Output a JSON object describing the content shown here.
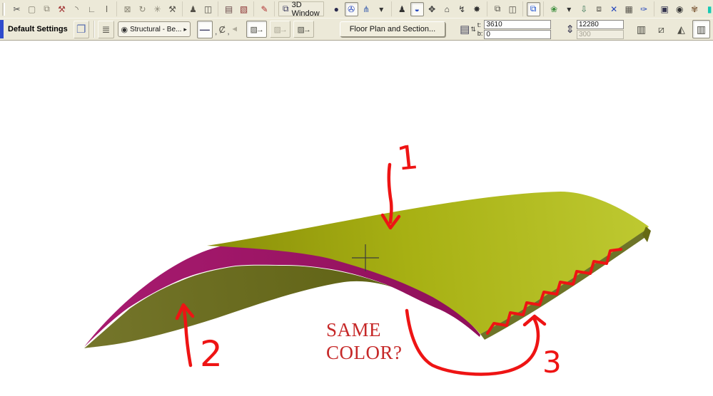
{
  "toolbar_top": {
    "window_button": {
      "label": "3D Window",
      "icon": "⧉"
    },
    "group1": [
      {
        "name": "scissors-icon",
        "glyph": "✂",
        "color": "#4a4a4a"
      },
      {
        "name": "fold-rect-icon",
        "glyph": "▢",
        "color": "#8a8676"
      },
      {
        "name": "copy-rect-icon",
        "glyph": "⧉",
        "color": "#8a8676"
      },
      {
        "name": "pick-hammer-icon",
        "glyph": "⚒",
        "color": "#a23535"
      },
      {
        "name": "fillet-arc-icon",
        "glyph": "◝",
        "color": "#6a675c"
      },
      {
        "name": "corner-tool-icon",
        "glyph": "∟",
        "color": "#6a675c"
      },
      {
        "name": "beam-tool-icon",
        "glyph": "Ⅰ",
        "color": "#6a675c"
      }
    ],
    "group2": [
      {
        "name": "delete-box-icon",
        "glyph": "⊠",
        "color": "#8a8676"
      },
      {
        "name": "rotate-icon",
        "glyph": "↻",
        "color": "#8a8676"
      },
      {
        "name": "explode-icon",
        "glyph": "✳",
        "color": "#8a8676"
      },
      {
        "name": "hammer-icon",
        "glyph": "⚒",
        "color": "#55524a"
      }
    ],
    "group3": [
      {
        "name": "walk-figure-icon",
        "glyph": "♟",
        "color": "#55524a"
      },
      {
        "name": "copy-element-icon",
        "glyph": "◫",
        "color": "#55524a"
      }
    ],
    "group4": [
      {
        "name": "print-icon",
        "glyph": "▤",
        "color": "#6a4a4a"
      },
      {
        "name": "publish-icon",
        "glyph": "▧",
        "color": "#8b3030"
      }
    ],
    "group5": [
      {
        "name": "markup-pencil-icon",
        "glyph": "✎",
        "color": "#b03030"
      }
    ],
    "group6": [
      {
        "name": "orbit-sphere-icon",
        "glyph": "●",
        "color": "#2b2b4f"
      },
      {
        "name": "explore-camera-icon",
        "glyph": "✇",
        "color": "#2244bb",
        "selected": true
      },
      {
        "name": "tripod-icon",
        "glyph": "⋔",
        "color": "#3a5fae"
      },
      {
        "name": "tripod-dropdown-icon",
        "glyph": "▾",
        "color": "#333333"
      }
    ],
    "group7": [
      {
        "name": "walk-person-icon",
        "glyph": "♟",
        "color": "#333333"
      },
      {
        "name": "vr-helmet-icon",
        "glyph": "◒",
        "color": "#2244bb",
        "selected": true
      },
      {
        "name": "pan-arrows-icon",
        "glyph": "✥",
        "color": "#333333"
      },
      {
        "name": "home-icon",
        "glyph": "⌂",
        "color": "#333333"
      },
      {
        "name": "actor-flash-icon",
        "glyph": "↯",
        "color": "#333333"
      },
      {
        "name": "camera-burst-icon",
        "glyph": "✸",
        "color": "#333333"
      }
    ],
    "group8": [
      {
        "name": "copy-clipboard-icon",
        "glyph": "⧉",
        "color": "#55524a"
      },
      {
        "name": "paste-clipboard-icon",
        "glyph": "◫",
        "color": "#55524a"
      }
    ],
    "group9": [
      {
        "name": "blue-clipboard-icon",
        "glyph": "⧉",
        "color": "#1a4fd0",
        "selected": true
      }
    ],
    "group10": [
      {
        "name": "plant-icon",
        "glyph": "❀",
        "color": "#3f8f3f"
      },
      {
        "name": "plant-dropdown-icon",
        "glyph": "▾",
        "color": "#333333"
      },
      {
        "name": "drop-anchor-icon",
        "glyph": "⇩",
        "color": "#2f6f4f"
      },
      {
        "name": "picture-export-icon",
        "glyph": "⧈",
        "color": "#55524a"
      },
      {
        "name": "cut-x-icon",
        "glyph": "✕",
        "color": "#2244bb"
      },
      {
        "name": "window-grid-icon",
        "glyph": "▦",
        "color": "#55524a"
      },
      {
        "name": "paint-brush-icon",
        "glyph": "✑",
        "color": "#2244bb"
      }
    ],
    "group11": [
      {
        "name": "dark-window-icon",
        "glyph": "▣",
        "color": "#33334f"
      },
      {
        "name": "camera-icon",
        "glyph": "◉",
        "color": "#333333"
      },
      {
        "name": "paw-icon",
        "glyph": "✾",
        "color": "#8a6a4a"
      },
      {
        "name": "teal-column-icon",
        "glyph": "▮",
        "color": "#15c9b4"
      }
    ]
  },
  "toolbar_info": {
    "default_settings_label": "Default Settings",
    "settings_icon": "❐",
    "layers_icon": "≣",
    "layer_dropdown": {
      "eye_icon": "◉",
      "label": "Structural - Be...",
      "arrow": "▸"
    },
    "line_button_icon": "—",
    "dropdown_mark": ",",
    "arc_icon": "Ȼ",
    "dropdown_mark2": ",",
    "flag_icon": "◄",
    "fill_buttons": [
      {
        "name": "fill-handle-button",
        "glyph": "▨→",
        "selected": true
      },
      {
        "name": "fill-handle-gray-button",
        "glyph": "▨→",
        "disabled": true
      },
      {
        "name": "fill-vector-button",
        "glyph": "▨→"
      }
    ],
    "floor_plan_button": "Floor Plan and Section...",
    "wall_icon": "▤",
    "updown_icon": "⇅",
    "t_label": "t:",
    "b_label": "b:",
    "t_value": "3610",
    "b_value": "0",
    "height_icon": "⇕",
    "len_value": "12280",
    "sub_value": "300",
    "column_buttons": [
      {
        "name": "column-straight-button",
        "glyph": "▥"
      },
      {
        "name": "column-slanted-button",
        "glyph": "⧄"
      },
      {
        "name": "column-tapered-button",
        "glyph": "◭"
      },
      {
        "name": "column-base-button",
        "glyph": "▥",
        "selected": true
      }
    ]
  },
  "viewport": {
    "annotations": {
      "label1": "1",
      "label2": "2",
      "label3": "3",
      "question_line1": "SAME",
      "question_line2": "COLOR?",
      "pen_color": "#ee1414",
      "text_color": "#c62828"
    },
    "shape_colors": {
      "top_left": "#8a8e09",
      "top_mid": "#a7b013",
      "top_right": "#bec931",
      "band_left": "#a81b70",
      "band_right": "#8f0f5a",
      "soffit_left": "#74752a",
      "soffit_right": "#5f6214",
      "strip": "#6d7428",
      "cap": "#666a14"
    }
  }
}
